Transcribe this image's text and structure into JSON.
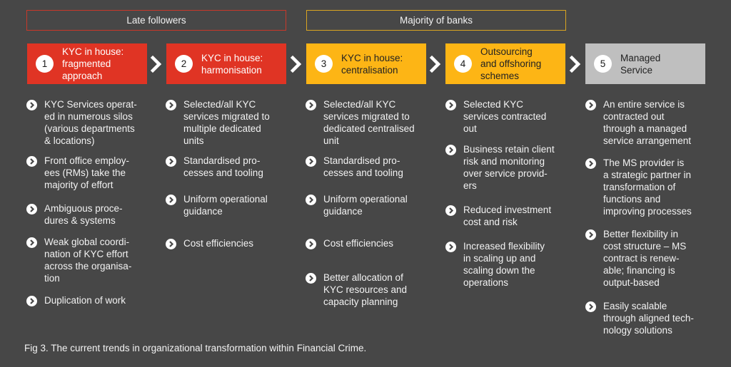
{
  "groups": {
    "late_followers": "Late followers",
    "majority_of_banks": "Majority of banks"
  },
  "colors": {
    "background": "#474747",
    "late_followers_border": "#c8382a",
    "majority_border": "#d9a521",
    "step_red": "#e03424",
    "step_amber": "#fdb515",
    "step_gray": "#bfbfbf"
  },
  "steps": [
    {
      "number": "1",
      "label": "KYC in house:\nfragmented\napproach"
    },
    {
      "number": "2",
      "label": "KYC in house:\nharmonisation"
    },
    {
      "number": "3",
      "label": "KYC in house:\ncentralisation"
    },
    {
      "number": "4",
      "label": "Outsourcing\nand offshoring\nschemes"
    },
    {
      "number": "5",
      "label": "Managed\nService"
    }
  ],
  "columns": [
    {
      "items": [
        "KYC Services operat-\ned in numerous silos\n(various departments\n& locations)",
        "Front office employ-\nees (RMs) take the\nmajority of effort",
        "Ambiguous proce-\ndures & systems",
        "Weak global coordi-\nnation of KYC effort\nacross the organisa-\ntion",
        "Duplication of work"
      ]
    },
    {
      "items": [
        "Selected/all KYC\nservices migrated to\nmultiple dedicated\nunits",
        "Standardised pro-\ncesses and tooling",
        "Uniform operational\nguidance",
        "Cost efficiencies"
      ]
    },
    {
      "items": [
        "Selected/all KYC\nservices migrated to\ndedicated centralised\nunit",
        "Standardised pro-\ncesses and tooling",
        "Uniform operational\nguidance",
        "Cost efficiencies",
        "Better allocation of\nKYC resources and\ncapacity planning"
      ]
    },
    {
      "items": [
        "Selected KYC\nservices contracted\nout",
        "Business retain client\nrisk and monitoring\nover service provid-\ners",
        "Reduced investment\ncost and risk",
        "Increased flexibility\nin scaling up and\nscaling down the\noperations"
      ]
    },
    {
      "items": [
        "An entire service is\ncontracted out\nthrough a managed\nservice arrangement",
        "The MS provider is\na strategic partner in\ntransformation of\nfunctions and\nimproving processes",
        "Better flexibility in\ncost structure – MS\ncontract is renew-\nable; financing is\noutput-based",
        "Easily scalable\nthrough aligned tech-\nnology solutions"
      ]
    }
  ],
  "caption": "Fig 3. The current trends in organizational transformation within Financial Crime."
}
